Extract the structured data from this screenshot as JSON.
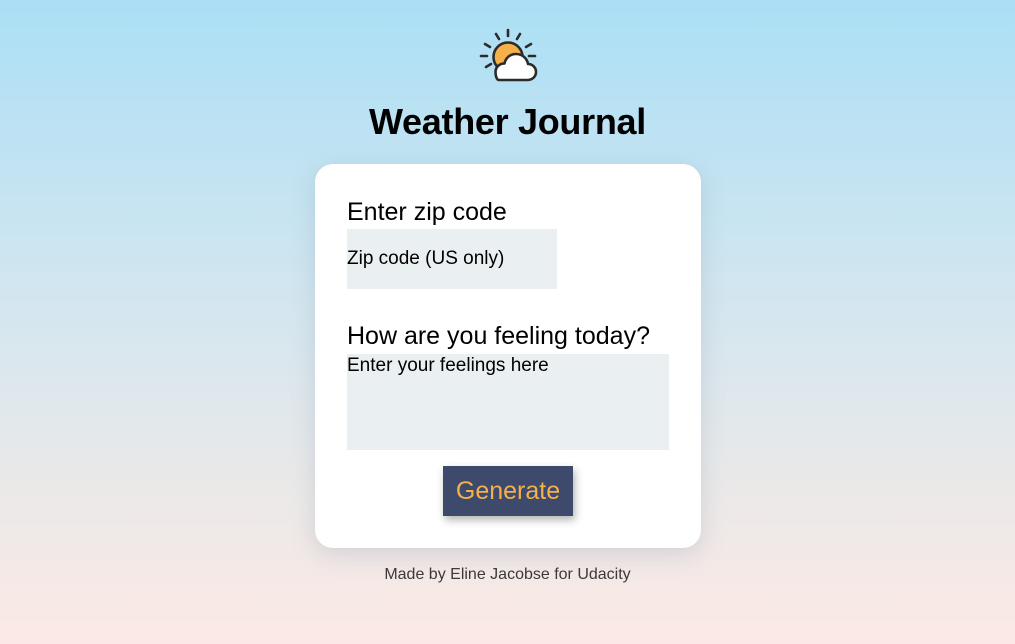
{
  "header": {
    "logo_icon": "sun-behind-cloud-icon",
    "title": "Weather Journal"
  },
  "form": {
    "zip_label": "Enter zip code",
    "zip_placeholder": "Zip code (US only)",
    "zip_value": "",
    "feelings_label": "How are you feeling today?",
    "feelings_placeholder": "Enter your feelings here",
    "feelings_value": "",
    "generate_label": "Generate"
  },
  "footer": {
    "text": "Made by Eline Jacobse for Udacity"
  },
  "colors": {
    "sun": "#f6b04a",
    "button_bg": "#3d4a6c",
    "button_text": "#f6b04a",
    "input_bg": "#eaeff1",
    "gradient_top": "#abdff5",
    "gradient_bottom": "#fce9e5"
  }
}
